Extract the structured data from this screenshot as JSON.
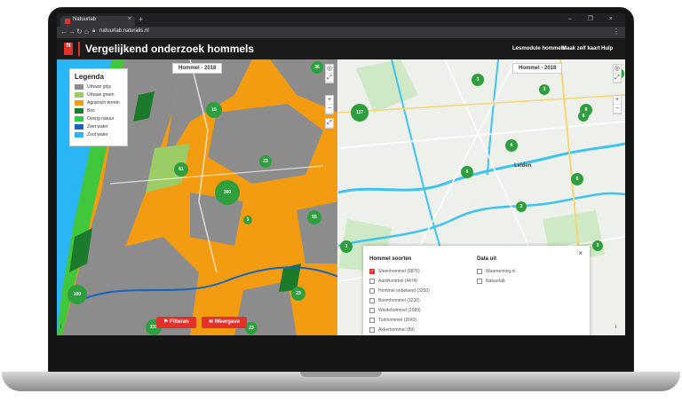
{
  "browser": {
    "tab_title": "Natuurlab",
    "tab_close": "×",
    "new_tab": "+",
    "window_controls": "– ❐ ×",
    "url": "natuurlab.naturalis.nl"
  },
  "header": {
    "logo_text": "N",
    "title": "Vergelijkend onderzoek hommels",
    "links": [
      "Lesmodule hommels",
      "Maak zelf kaart",
      "Hulp"
    ]
  },
  "map_left": {
    "label": "Hommel - 2018",
    "legend": {
      "title": "Legenda",
      "items": [
        {
          "label": "Urbaan grijs",
          "color": "#8c8c8c"
        },
        {
          "label": "Urbaan groen",
          "color": "#9ccc65"
        },
        {
          "label": "Agrarisch terrein",
          "color": "#f39c12"
        },
        {
          "label": "Bos",
          "color": "#1b7a2b"
        },
        {
          "label": "Overig natuur",
          "color": "#2ecc40"
        },
        {
          "label": "Zoet water",
          "color": "#1565c0"
        },
        {
          "label": "Zout water",
          "color": "#29b6f6"
        }
      ]
    },
    "clusters": [
      "36",
      "15",
      "61",
      "360",
      "23",
      "3",
      "55",
      "100",
      "23",
      "237",
      "23"
    ],
    "buttons": {
      "filter": "Filteren",
      "view": "Weergave"
    }
  },
  "map_right": {
    "label": "Hommel - 2018",
    "clusters": [
      "3",
      "3",
      "8",
      "117",
      "6",
      "6",
      "6",
      "2",
      "8",
      "6",
      "3",
      "6",
      "3"
    ],
    "place_label": "Leiden"
  },
  "filter_panel": {
    "close": "×",
    "species_heading": "Hommel soorten",
    "species": [
      {
        "label": "Steenhommel (6876)",
        "checked": true
      },
      {
        "label": "Aardhommel (4474)",
        "checked": false
      },
      {
        "label": "Hommel onbekend (3250)",
        "checked": false
      },
      {
        "label": "Boomhommel (3230)",
        "checked": false
      },
      {
        "label": "Weidehommel (2589)",
        "checked": false
      },
      {
        "label": "Tuinhommel (2043)",
        "checked": false
      },
      {
        "label": "Akkerhommel (89)",
        "checked": false
      }
    ],
    "source_heading": "Data uit",
    "sources": [
      {
        "label": "Waarneming.nl",
        "checked": false
      },
      {
        "label": "Natuurlab",
        "checked": false
      }
    ]
  },
  "map_controls": {
    "locate": "◎",
    "zoom_in": "+",
    "zoom_out": "−",
    "fullscreen": "⤢",
    "info": "i"
  },
  "icons": {
    "back": "arrow-left-icon",
    "forward": "arrow-right-icon",
    "reload": "reload-icon",
    "home": "home-icon",
    "lock": "lock-icon"
  }
}
